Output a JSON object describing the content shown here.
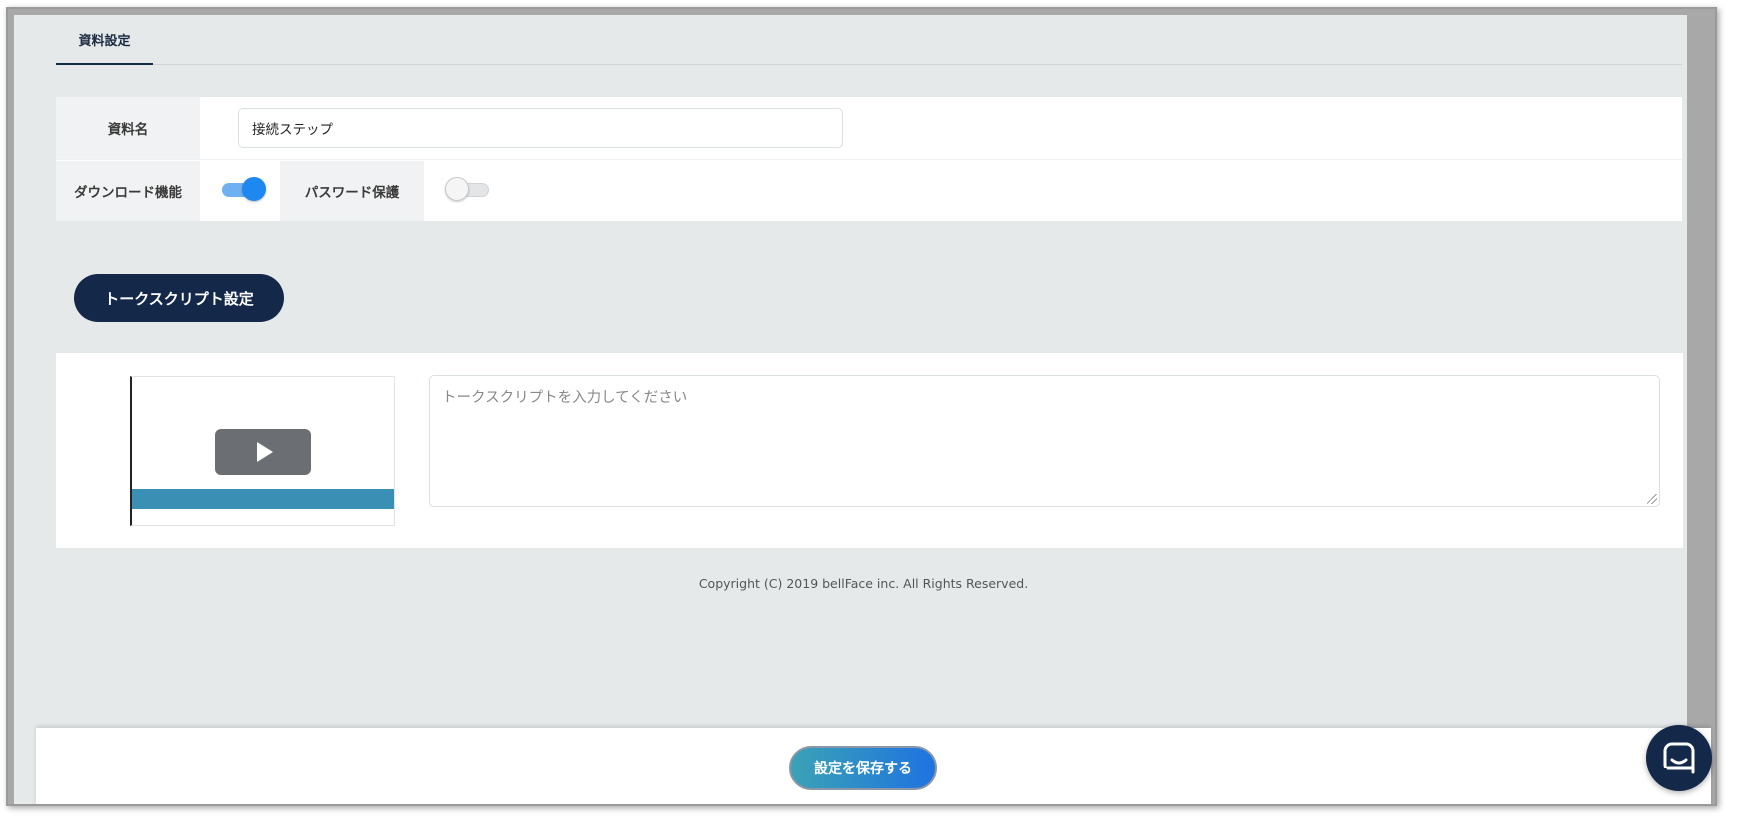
{
  "tabs": [
    {
      "label": "資料設定",
      "active": true
    }
  ],
  "settings": {
    "name_label": "資料名",
    "name_value": "接続ステップ",
    "download_label": "ダウンロード機能",
    "download_enabled": true,
    "password_label": "パスワード保護",
    "password_enabled": false
  },
  "talk_script": {
    "heading": "トークスクリプト設定",
    "placeholder": "トークスクリプトを入力してください",
    "value": ""
  },
  "footer": {
    "copyright": "Copyright (C) 2019 bellFace inc. All Rights Reserved.",
    "save_label": "設定を保存する"
  },
  "colors": {
    "navy": "#14284a",
    "toggle_on": "#1e88f0",
    "save_gradient_start": "#3aa2b6",
    "save_gradient_end": "#1f73e0",
    "page_bg": "#e6e9ea"
  },
  "icons": {
    "play": "play-icon",
    "chat": "chat-icon"
  }
}
